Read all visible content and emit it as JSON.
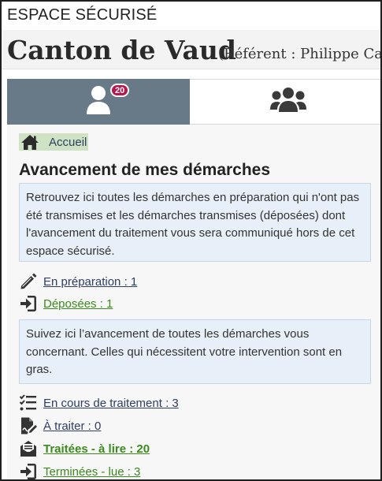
{
  "header": {
    "espace": "ESPACE SÉCURISÉ",
    "canton": "Canton de Vaud",
    "referent": "(Référent : Philippe Cam"
  },
  "tabs": [
    {
      "id": "personal",
      "icon": "user-icon",
      "badge": "20",
      "active": true
    },
    {
      "id": "group",
      "icon": "users-group-icon",
      "active": false
    }
  ],
  "breadcrumb": {
    "home_icon": "home-icon",
    "label": "Accueil"
  },
  "main": {
    "title": "Avancement de mes démarches",
    "info1": "Retrouvez ici toutes les démarches en préparation qui n'ont pas été transmises et les démarches transmises (déposées) dont l'avancement du traitement vous sera communiqué hors de cet espace sécurisé.",
    "links1": [
      {
        "icon": "pencil-icon",
        "label": "En préparation : 1",
        "color": "#2f3e63"
      },
      {
        "icon": "sign-in-icon",
        "label": "Déposées : 1",
        "color": "#3c8a1e"
      }
    ],
    "info2": "Suivez ici l’avancement de toutes les démarches vous concernant. Celles qui nécessitent votre intervention sont en gras.",
    "links2": [
      {
        "icon": "tasks-list-icon",
        "label": "En cours de traitement : 3",
        "color": "#2f3e63"
      },
      {
        "icon": "document-signature-icon",
        "label": "À traiter : 0",
        "color": "#2f3e63"
      },
      {
        "icon": "envelope-open-icon",
        "label": "Traitées - à lire : 20",
        "color": "#3c8a1e",
        "bold": true
      },
      {
        "icon": "sign-in-icon",
        "label": "Terminées - lue : 3",
        "color": "#3c8a1e"
      }
    ]
  }
}
